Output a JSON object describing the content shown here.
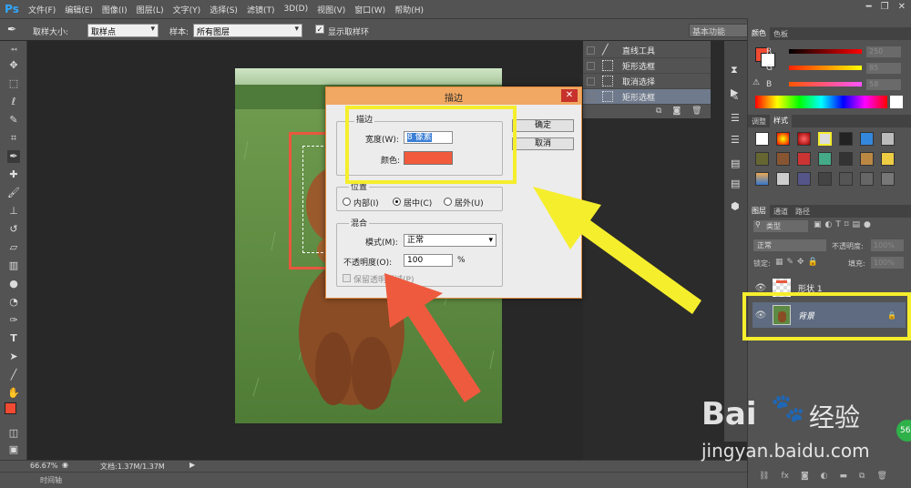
{
  "app": {
    "logo": "Ps",
    "menu": [
      "文件(F)",
      "编辑(E)",
      "图像(I)",
      "图层(L)",
      "文字(Y)",
      "选择(S)",
      "滤镜(T)",
      "3D(D)",
      "视图(V)",
      "窗口(W)",
      "帮助(H)"
    ]
  },
  "options_bar": {
    "sample_size_label": "取样大小:",
    "sample_size_value": "取样点",
    "sample_label": "样本:",
    "sample_value": "所有图层",
    "show_ring_label": "显示取样环",
    "workspace": "基本功能"
  },
  "history": {
    "items": [
      {
        "label": "直线工具",
        "selected": false
      },
      {
        "label": "矩形选框",
        "selected": false
      },
      {
        "label": "取消选择",
        "selected": false
      },
      {
        "label": "矩形选框",
        "selected": true
      }
    ]
  },
  "color_panel": {
    "tabs": [
      "颜色",
      "色板"
    ],
    "fg_color": "#f04a32",
    "channels": [
      {
        "label": "R",
        "value": "250"
      },
      {
        "label": "G",
        "value": "85"
      },
      {
        "label": "B",
        "value": "58"
      }
    ]
  },
  "styles_panel": {
    "tabs": [
      "调整",
      "样式"
    ]
  },
  "layers_panel": {
    "tabs": [
      "图层",
      "通道",
      "路径"
    ],
    "filter": "类型",
    "blend": "正常",
    "opacity_label": "不透明度:",
    "opacity_value": "100%",
    "lock_label": "锁定:",
    "fill_label": "填充:",
    "fill_value": "100%",
    "layers": [
      {
        "name": "形状 1",
        "selected": false
      },
      {
        "name": "背景",
        "selected": true
      }
    ]
  },
  "status": {
    "zoom": "66.67%",
    "doc": "文档:1.37M/1.37M",
    "timeline": "时间轴"
  },
  "dialog": {
    "title": "描边",
    "stroke_group": "描边",
    "width_label": "宽度(W):",
    "width_value": "8 像素",
    "color_label": "颜色:",
    "stroke_color": "#f25a3c",
    "ok": "确定",
    "cancel": "取消",
    "position_group": "位置",
    "pos_inside": "内部(I)",
    "pos_center": "居中(C)",
    "pos_outside": "居外(U)",
    "blend_group": "混合",
    "mode_label": "模式(M):",
    "mode_value": "正常",
    "opacity_label": "不透明度(O):",
    "opacity_value": "100",
    "percent": "%",
    "preserve_label": "保留透明区域(P)"
  },
  "watermark": {
    "brand": "Bai",
    "brand2": "经验",
    "url": "jingyan.baidu.com",
    "badge": "56"
  }
}
